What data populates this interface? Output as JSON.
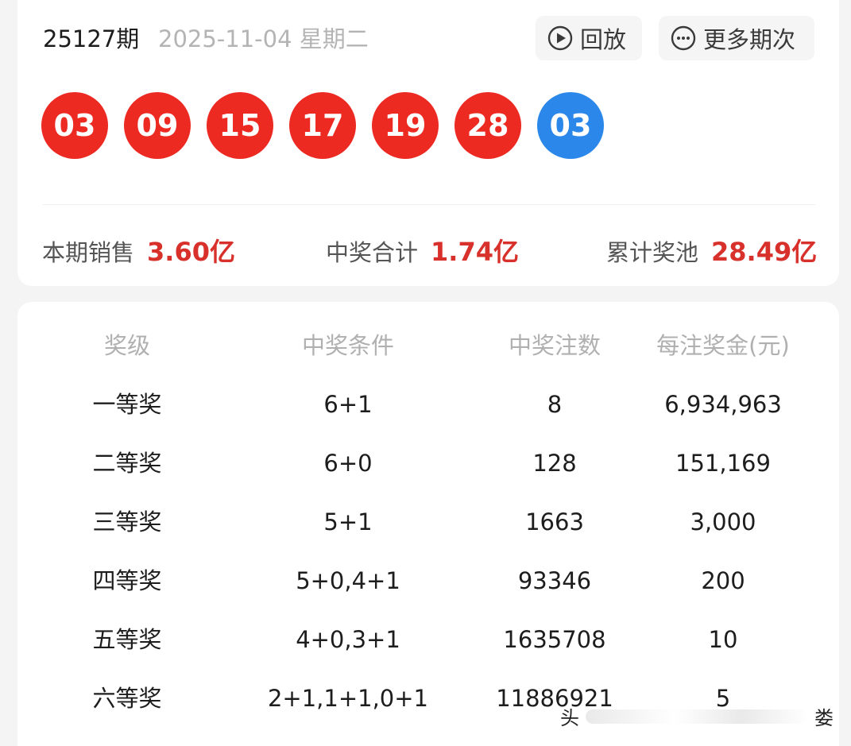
{
  "header": {
    "issue": "25127期",
    "date": "2025-11-04 星期二",
    "replay_label": "回放",
    "more_label": "更多期次"
  },
  "numbers": {
    "red": [
      "03",
      "09",
      "15",
      "17",
      "19",
      "28"
    ],
    "blue": [
      "03"
    ],
    "red_color": "#ec2a22",
    "blue_color": "#2b88ea"
  },
  "summary": {
    "sales_label": "本期销售",
    "sales_value": "3.60亿",
    "winnings_label": "中奖合计",
    "winnings_value": "1.74亿",
    "pool_label": "累计奖池",
    "pool_value": "28.49亿"
  },
  "table": {
    "headers": [
      "奖级",
      "中奖条件",
      "中奖注数",
      "每注奖金(元)"
    ],
    "rows": [
      [
        "一等奖",
        "6+1",
        "8",
        "6,934,963"
      ],
      [
        "二等奖",
        "6+0",
        "128",
        "151,169"
      ],
      [
        "三等奖",
        "5+1",
        "1663",
        "3,000"
      ],
      [
        "四等奖",
        "5+0,4+1",
        "93346",
        "200"
      ],
      [
        "五等奖",
        "4+0,3+1",
        "1635708",
        "10"
      ],
      [
        "六等奖",
        "2+1,1+1,0+1",
        "11886921",
        "5"
      ]
    ]
  },
  "watermark": {
    "left": "头",
    "right": "娄"
  }
}
